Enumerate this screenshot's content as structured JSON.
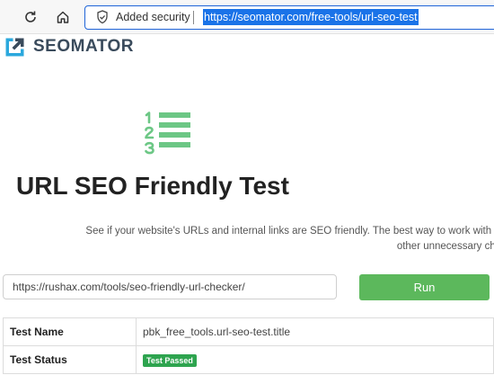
{
  "browser": {
    "security_label": "Added security",
    "url": "https://seomator.com/free-tools/url-seo-test"
  },
  "logo": {
    "text": "SEOMATOR"
  },
  "page": {
    "title": "URL SEO Friendly Test",
    "description_line1": "See if your website's URLs and internal links are SEO friendly. The best way to work with it is t",
    "description_line2": "other unnecessary char"
  },
  "form": {
    "url_value": "https://rushax.com/tools/seo-friendly-url-checker/",
    "run_label": "Run"
  },
  "results": [
    {
      "key": "Test Name",
      "value": "pbk_free_tools.url-seo-test.title"
    },
    {
      "key": "Test Status",
      "badge": "Test Passed"
    }
  ],
  "colors": {
    "accent": "#5cb85c",
    "icon_green": "#6cc785",
    "badge": "#2ea44f",
    "url_highlight": "#1a73e8"
  }
}
